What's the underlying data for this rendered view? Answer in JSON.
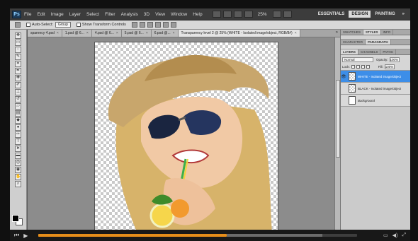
{
  "menubar": {
    "logo": "Ps",
    "items": [
      "File",
      "Edit",
      "Image",
      "Layer",
      "Select",
      "Filter",
      "Analysis",
      "3D",
      "View",
      "Window",
      "Help"
    ],
    "zoom": "25%",
    "workspaces": [
      "ESSENTIALS",
      "DESIGN",
      "PAINTING"
    ],
    "active_workspace": "DESIGN",
    "more": "»"
  },
  "options": {
    "auto_select_label": "Auto-Select:",
    "auto_select_value": "Group",
    "show_transform_label": "Show Transform Controls"
  },
  "tabs": [
    {
      "label": "sparency 4.psd"
    },
    {
      "label": "1.psd @ 6..."
    },
    {
      "label": "4.psd @ 6..."
    },
    {
      "label": "5.psd @ 6..."
    },
    {
      "label": "6.psd @..."
    },
    {
      "label": "Transparency level 2 @ 25% (WHITE - Isolated image/object, RGB/8#)"
    }
  ],
  "tabs_more": "»",
  "panels": {
    "top_tabs": [
      "SWATCHES",
      "STYLES",
      "INFO"
    ],
    "mid_tabs": [
      "CHARACTER",
      "PARAGRAPH"
    ],
    "layer_tabs": [
      "LAYERS",
      "CHANNELS",
      "PATHS"
    ],
    "blend_mode": "Normal",
    "opacity_label": "Opacity:",
    "opacity_value": "100%",
    "lock_label": "Lock:",
    "fill_label": "Fill:",
    "fill_value": "100%",
    "layers": [
      {
        "name": "WHITE - Isolated image/object",
        "selected": true
      },
      {
        "name": "BLACK - Isolated image/object",
        "selected": false
      },
      {
        "name": "Background",
        "selected": false
      }
    ]
  },
  "player": {
    "progress": 0.59,
    "buffered": 0.89
  },
  "colors": {
    "accent": "#e58d1a",
    "selection": "#3d8ee8"
  }
}
